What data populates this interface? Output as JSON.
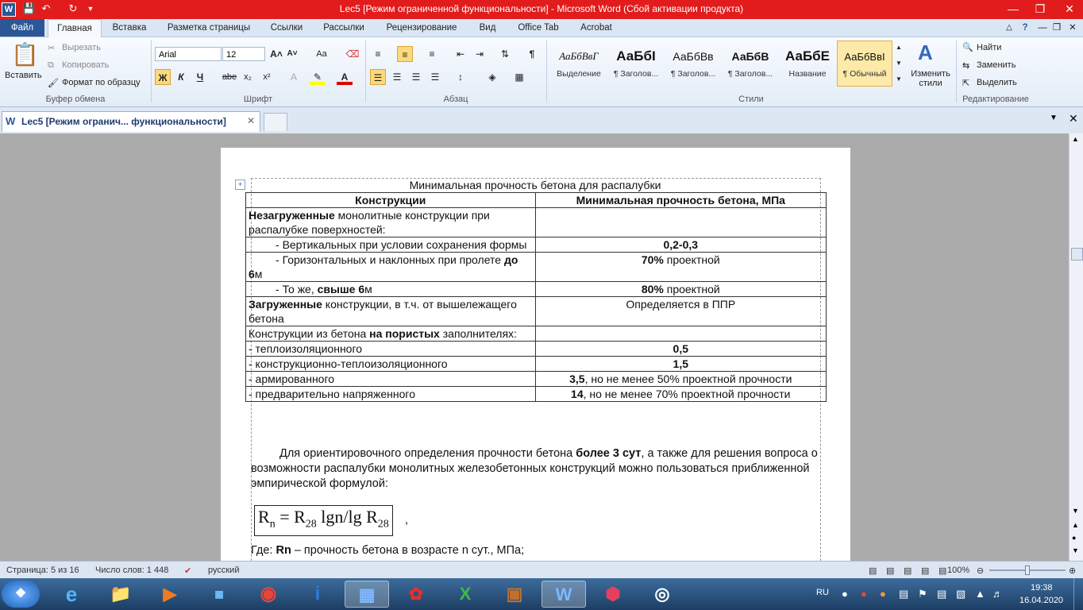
{
  "window": {
    "title": "Lec5 [Режим ограниченной функциональности]  -  Microsoft Word (Сбой активации продукта)"
  },
  "ribbon_tabs": [
    "Файл",
    "Главная",
    "Вставка",
    "Разметка страницы",
    "Ссылки",
    "Рассылки",
    "Рецензирование",
    "Вид",
    "Office Tab",
    "Acrobat"
  ],
  "clipboard": {
    "paste": "Вставить",
    "cut": "Вырезать",
    "copy": "Копировать",
    "format_painter": "Формат по образцу",
    "group": "Буфер обмена"
  },
  "font": {
    "name": "Arial",
    "size": "12",
    "group": "Шрифт",
    "bold": "Ж",
    "italic": "К",
    "underline": "Ч",
    "strike": "abe",
    "sub": "x₂",
    "sup": "x²",
    "case": "Aa"
  },
  "paragraph": {
    "group": "Абзац"
  },
  "styles": {
    "group": "Стили",
    "items": [
      {
        "sample": "АаБбВвГ",
        "name": "Выделение"
      },
      {
        "sample": "АаБбІ",
        "name": "¶ Заголов..."
      },
      {
        "sample": "АаБбВв",
        "name": "¶ Заголов..."
      },
      {
        "sample": "АаБбВ",
        "name": "¶ Заголов..."
      },
      {
        "sample": "АаБбЕ",
        "name": "Название"
      },
      {
        "sample": "АаБбВвІ",
        "name": "¶ Обычный"
      }
    ],
    "change": "Изменить стили"
  },
  "editing": {
    "group": "Редактирование",
    "find": "Найти",
    "replace": "Заменить",
    "select": "Выделить"
  },
  "doc_tab": {
    "label": "Lec5 [Режим огранич... функциональности]"
  },
  "document": {
    "table_caption": "Минимальная прочность бетона для распалубки",
    "headers": [
      "Конструкции",
      "Минимальная прочность бетона, МПа"
    ],
    "rows": [
      {
        "b1": "Незагруженные",
        "t1": " монолитные конструкции при распалубке поверхностей:",
        "v_b": "",
        "v_t": ""
      },
      {
        "pre": "        - ",
        "t1": "Вертикальных при условии сохранения формы",
        "v_b": "0,2-0,3",
        "v_t": ""
      },
      {
        "pre": "        - ",
        "t1": "Горизонтальных и наклонных при пролете ",
        "b2": "до 6",
        "t2": "м",
        "v_b": "70%",
        "v_t": " проектной"
      },
      {
        "pre": "        - ",
        "t1": "То же, ",
        "b2": "свыше 6",
        "t2": "м",
        "v_b": "80%",
        "v_t": " проектной"
      },
      {
        "b1": "Загруженные",
        "t1": " конструкции, в т.ч. от вышележащего бетона",
        "v_b": "",
        "v_t": "Определяется в ППР"
      },
      {
        "t1": "Конструкции из бетона ",
        "b2": "на пористых",
        "t2": " заполнителях:",
        "v_b": "",
        "v_t": ""
      },
      {
        "t1": "- теплоизоляционного",
        "v_b": "0,5",
        "v_t": ""
      },
      {
        "t1": "- конструкционно-теплоизоляционного",
        "v_b": "1,5",
        "v_t": ""
      },
      {
        "t1": "- армированного",
        "v_b": "3,5",
        "v_t": ", но не менее 50% проектной прочности"
      },
      {
        "t1": "- предварительно напряженного",
        "v_b": "14",
        "v_t": ", но не менее 70% проектной прочности"
      }
    ],
    "para1_a": "Для ориентировочного определения прочности бетона ",
    "para1_b": "более 3 сут",
    "para1_c": ", а также для решения вопроса о возможности распалубки монолитных железобетонных конструкций можно пользоваться приближенной эмпирической формулой:",
    "formula": "Rn = R28 lgn/lg R28",
    "formula_tail": ",",
    "para2_a": "Где: ",
    "para2_b": "Rn",
    "para2_c": " – прочность бетона в возрасте n сут., МПа;"
  },
  "status": {
    "page": "Страница: 5 из 16",
    "words": "Число слов: 1 448",
    "lang": "русский",
    "zoom": "100%",
    "zoom_level": 0.5
  },
  "tray": {
    "lang": "RU",
    "time": "19:38",
    "date": "16.04.2020"
  }
}
